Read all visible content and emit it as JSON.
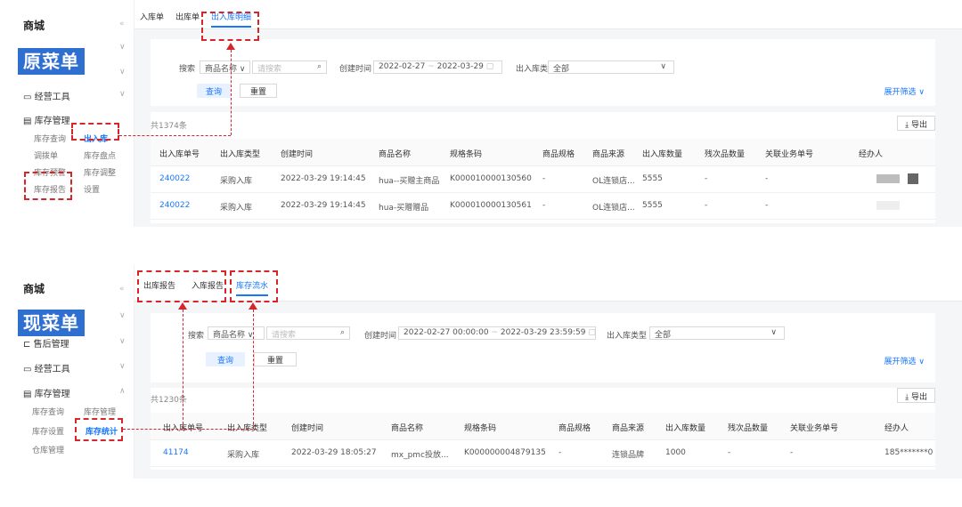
{
  "top": {
    "sidebar": {
      "brand": "商城",
      "collapse_icon": "«",
      "overlay_label": "原菜单",
      "items": [
        {
          "label": "经营工具",
          "icon": "tool-icon"
        },
        {
          "label": "库存管理",
          "icon": "inventory-icon"
        }
      ],
      "subitems": [
        "库存查询",
        "出入库",
        "调拨单",
        "库存盘点",
        "库存预警",
        "库存调整",
        "库存报告",
        "设置"
      ]
    },
    "tabs": [
      "入库单",
      "出库单",
      "出入库明细"
    ],
    "active_tab": "出入库明细",
    "filters": {
      "search_label": "搜索",
      "search_field_select": "商品名称",
      "search_placeholder": "请搜索",
      "created_label": "创建时间",
      "date_start": "2022-02-27",
      "date_sep": "~",
      "date_end": "2022-03-29",
      "type_label": "出入库类型",
      "type_value": "全部",
      "query_btn": "查询",
      "reset_btn": "重置",
      "expand": "展开筛选 ∨"
    },
    "count": "共1374条",
    "export": "导出",
    "columns": [
      "出入库单号",
      "出入库类型",
      "创建时间",
      "商品名称",
      "规格条码",
      "商品规格",
      "商品来源",
      "出入库数量",
      "残次品数量",
      "关联业务单号",
      "经办人"
    ],
    "rows": [
      [
        "240022",
        "采购入库",
        "2022-03-29 19:14:45",
        "hua--买赠主商品",
        "K000010000130560",
        "-",
        "OL连锁店...",
        "5555",
        "-",
        "-"
      ],
      [
        "240022",
        "采购入库",
        "2022-03-29 19:14:45",
        "hua-买赠赠品",
        "K000010000130561",
        "-",
        "OL连锁店...",
        "5555",
        "-",
        "-"
      ]
    ]
  },
  "bottom": {
    "sidebar": {
      "brand": "商城",
      "collapse_icon": "«",
      "overlay_label": "现菜单",
      "items": [
        {
          "label": "售后管理",
          "icon": "aftersale-icon"
        },
        {
          "label": "经营工具",
          "icon": "tool-icon"
        },
        {
          "label": "库存管理",
          "icon": "inventory-icon"
        }
      ],
      "subitems": [
        "库存查询",
        "库存管理",
        "库存设置",
        "库存统计",
        "仓库管理"
      ]
    },
    "tabs": [
      "出库报告",
      "入库报告",
      "库存流水"
    ],
    "active_tab": "库存流水",
    "filters": {
      "search_label": "搜索",
      "search_field_select": "商品名称",
      "search_placeholder": "请搜索",
      "created_label": "创建时间",
      "date_start": "2022-02-27 00:00:00",
      "date_sep": "~",
      "date_end": "2022-03-29 23:59:59",
      "type_label": "出入库类型",
      "type_value": "全部",
      "query_btn": "查询",
      "reset_btn": "重置",
      "expand": "展开筛选 ∨"
    },
    "count": "共1230条",
    "export": "导出",
    "columns": [
      "出入库单号",
      "出入库类型",
      "创建时间",
      "商品名称",
      "规格条码",
      "商品规格",
      "商品来源",
      "出入库数量",
      "残次品数量",
      "关联业务单号",
      "经办人"
    ],
    "rows": [
      [
        "41174",
        "采购入库",
        "2022-03-29 18:05:27",
        "mx_pmc投放...",
        "K000000004879135",
        "-",
        "连锁品牌",
        "1000",
        "-",
        "-",
        "185*******0"
      ]
    ]
  },
  "colors": {
    "accent": "#1677ff",
    "annotation": "#d4262b",
    "label_bg": "#2f6fd0"
  }
}
